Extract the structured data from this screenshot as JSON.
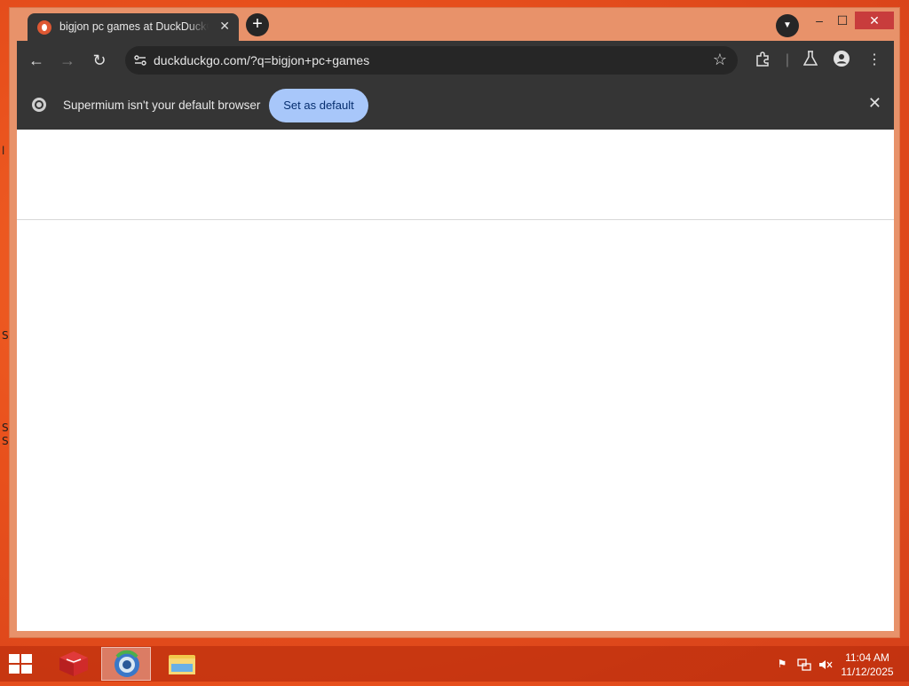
{
  "desktop": {
    "edge_glyphs": [
      "l",
      "S",
      "S",
      "S"
    ]
  },
  "browser": {
    "tab": {
      "title": "bigjon pc games at DuckDuckGo",
      "close_icon": "close-icon",
      "favicon": "duckduckgo-icon"
    },
    "new_tab_icon": "plus-icon",
    "tab_search_icon": "chevron-down-icon",
    "window_controls": {
      "minimize": "–",
      "maximize": "☐",
      "close": "✕"
    },
    "toolbar": {
      "back_icon": "back-arrow-icon",
      "forward_icon": "forward-arrow-icon",
      "reload_icon": "reload-icon",
      "url": "duckduckgo.com/?q=bigjon+pc+games",
      "bookmark_icon": "star-icon",
      "extensions_icon": "puzzle-icon",
      "labs_icon": "flask-icon",
      "profile_icon": "person-icon",
      "menu_icon": "kebab-menu-icon"
    },
    "infobar": {
      "message": "Supermium isn't your default browser",
      "button_label": "Set as default",
      "dismiss_icon": "close-icon"
    }
  },
  "taskbar": {
    "start_icon": "windows-logo-icon",
    "apps": [
      "package-app-icon",
      "supermium-browser-icon",
      "file-explorer-icon"
    ],
    "tray": [
      "flag-icon",
      "network-icon",
      "volume-muted-icon"
    ],
    "clock": {
      "time": "11:04 AM",
      "date": "11/12/2025"
    }
  },
  "colors": {
    "desktop": "#e8501c",
    "window_frame": "#e8926a",
    "browser_chrome": "#353535",
    "omnibox": "#262626",
    "accent_button": "#a8c7fa",
    "close_button": "#c83c3c"
  }
}
